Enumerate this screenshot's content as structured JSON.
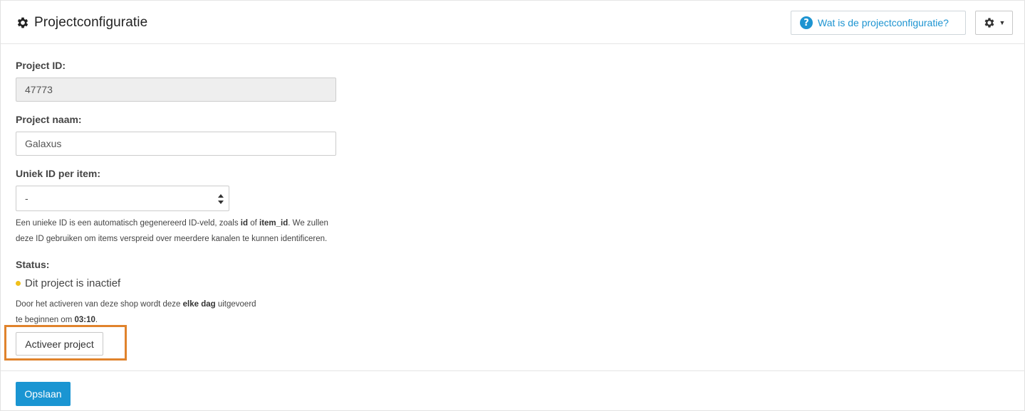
{
  "header": {
    "title": "Projectconfiguratie",
    "help_button_label": "Wat is de projectconfiguratie?",
    "help_icon_glyph": "?"
  },
  "form": {
    "project_id": {
      "label": "Project ID:",
      "value": "47773"
    },
    "project_name": {
      "label": "Project naam:",
      "value": "Galaxus"
    },
    "unique_id": {
      "label": "Uniek ID per item:",
      "selected": "-",
      "help_parts": {
        "part1": "Een unieke ID is een automatisch gegenereerd ID-veld, zoals ",
        "bold1": "id",
        "part2": " of ",
        "bold2": "item_id",
        "part3": ". We zullen",
        "line2": "deze ID gebruiken om items verspreid over meerdere kanalen te kunnen identificeren."
      }
    },
    "status": {
      "label": "Status:",
      "text": "Dit project is inactief",
      "dot_color": "#f0c01b",
      "activation": {
        "part1": "Door het activeren van deze shop wordt deze ",
        "bold1": "elke dag",
        "part2": " uitgevoerd",
        "line2_pre": "te beginnen om ",
        "time": "03:10",
        "line2_post": "."
      },
      "activate_button": "Activeer project"
    }
  },
  "footer": {
    "save_button": "Opslaan"
  },
  "colors": {
    "accent": "#1a95d2",
    "highlight": "#e0832c"
  }
}
